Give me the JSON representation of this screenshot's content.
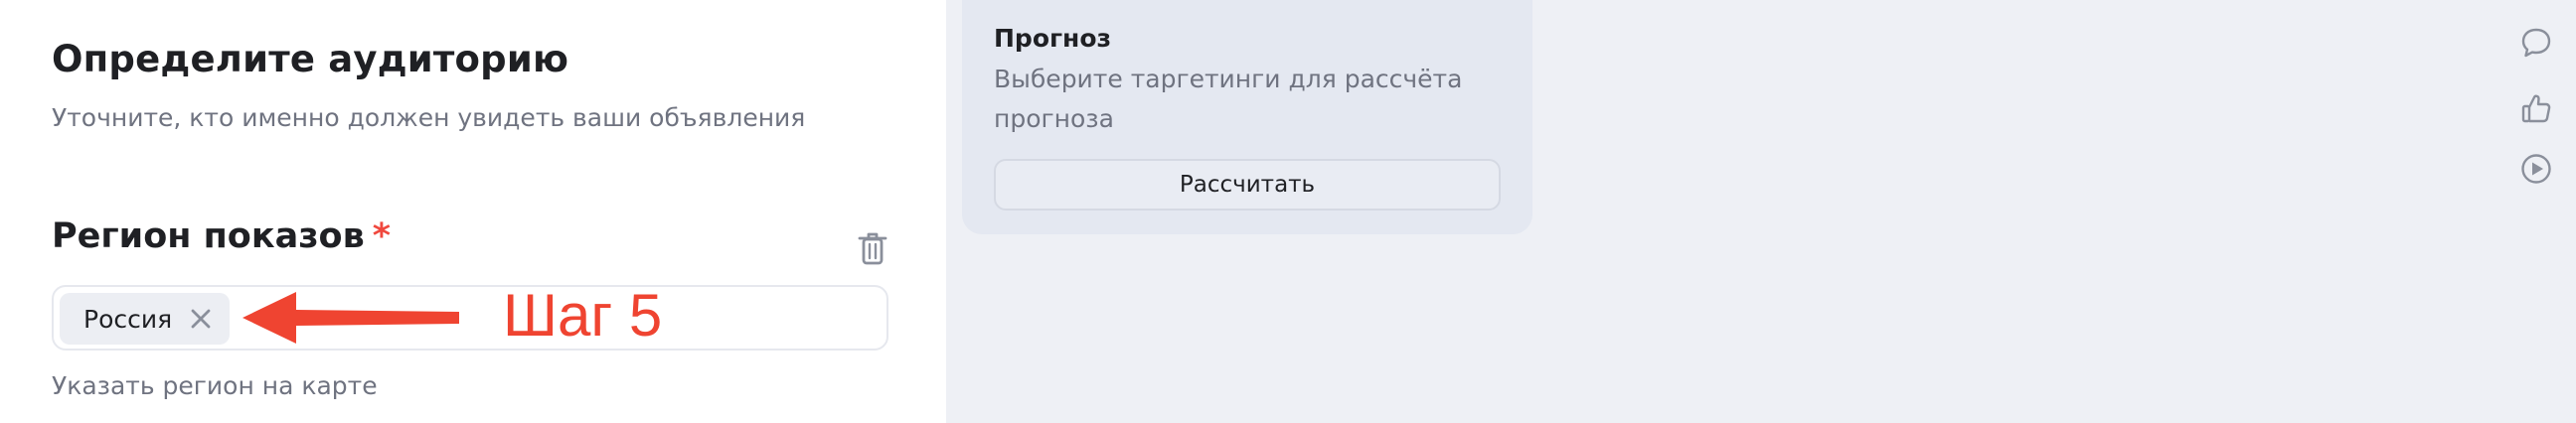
{
  "audience": {
    "title": "Определите аудиторию",
    "subtitle": "Уточните, кто именно должен увидеть ваши объявления"
  },
  "region": {
    "title": "Регион показов",
    "required_mark": "*",
    "chip_label": "Россия",
    "map_link": "Указать регион на карте"
  },
  "annotation": {
    "text": "Шаг 5",
    "color": "#ef4431"
  },
  "forecast": {
    "title": "Прогноз",
    "text": "Выберите таргетинги для рассчёта прогноза",
    "button_label": "Рассчитать"
  },
  "side_icons": [
    "comment-icon",
    "thumbs-up-icon",
    "play-icon"
  ],
  "colors": {
    "accent_required": "#f0483e",
    "background": "#eef0f5",
    "card": "#e4e8f1"
  }
}
